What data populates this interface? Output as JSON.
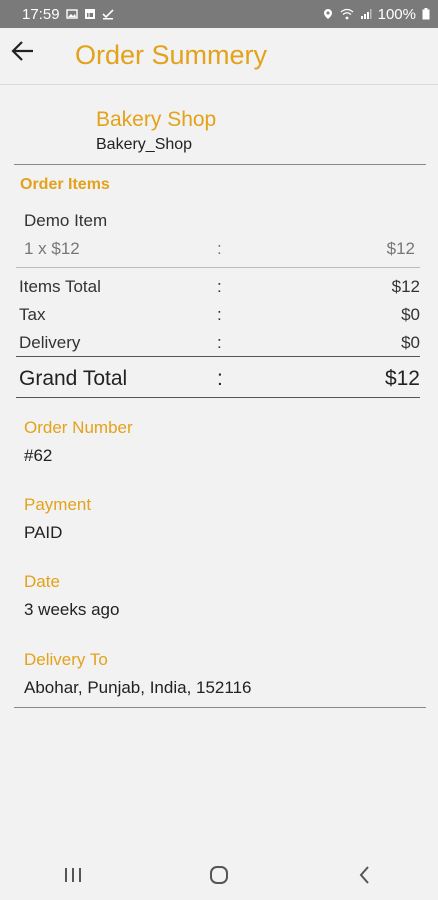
{
  "status_bar": {
    "time": "17:59",
    "battery": "100%"
  },
  "header": {
    "title": "Order Summery"
  },
  "shop": {
    "name": "Bakery Shop",
    "id": "Bakery_Shop"
  },
  "order_items": {
    "title": "Order Items",
    "items": [
      {
        "name": "Demo Item",
        "qty_price": "1 x $12",
        "sep": ":",
        "total": "$12"
      }
    ]
  },
  "totals": {
    "items_total": {
      "label": "Items Total",
      "sep": ":",
      "value": "$12"
    },
    "tax": {
      "label": "Tax",
      "sep": ":",
      "value": "$0"
    },
    "delivery": {
      "label": "Delivery",
      "sep": ":",
      "value": "$0"
    },
    "grand_total": {
      "label": "Grand Total",
      "sep": ":",
      "value": "$12"
    }
  },
  "details": {
    "order_number": {
      "label": "Order Number",
      "value": "#62"
    },
    "payment": {
      "label": "Payment",
      "value": "PAID"
    },
    "date": {
      "label": "Date",
      "value": "3 weeks ago"
    },
    "delivery_to": {
      "label": "Delivery To",
      "value": "Abohar, Punjab, India, 152116"
    }
  },
  "icons": {
    "back": "arrow-left-icon",
    "nav_recents": "recents-icon",
    "nav_home": "home-icon",
    "nav_back": "nav-back-icon"
  },
  "colors": {
    "accent": "#e3a21a",
    "status_bar": "#7a7a7a",
    "background": "#f2f2f2"
  }
}
